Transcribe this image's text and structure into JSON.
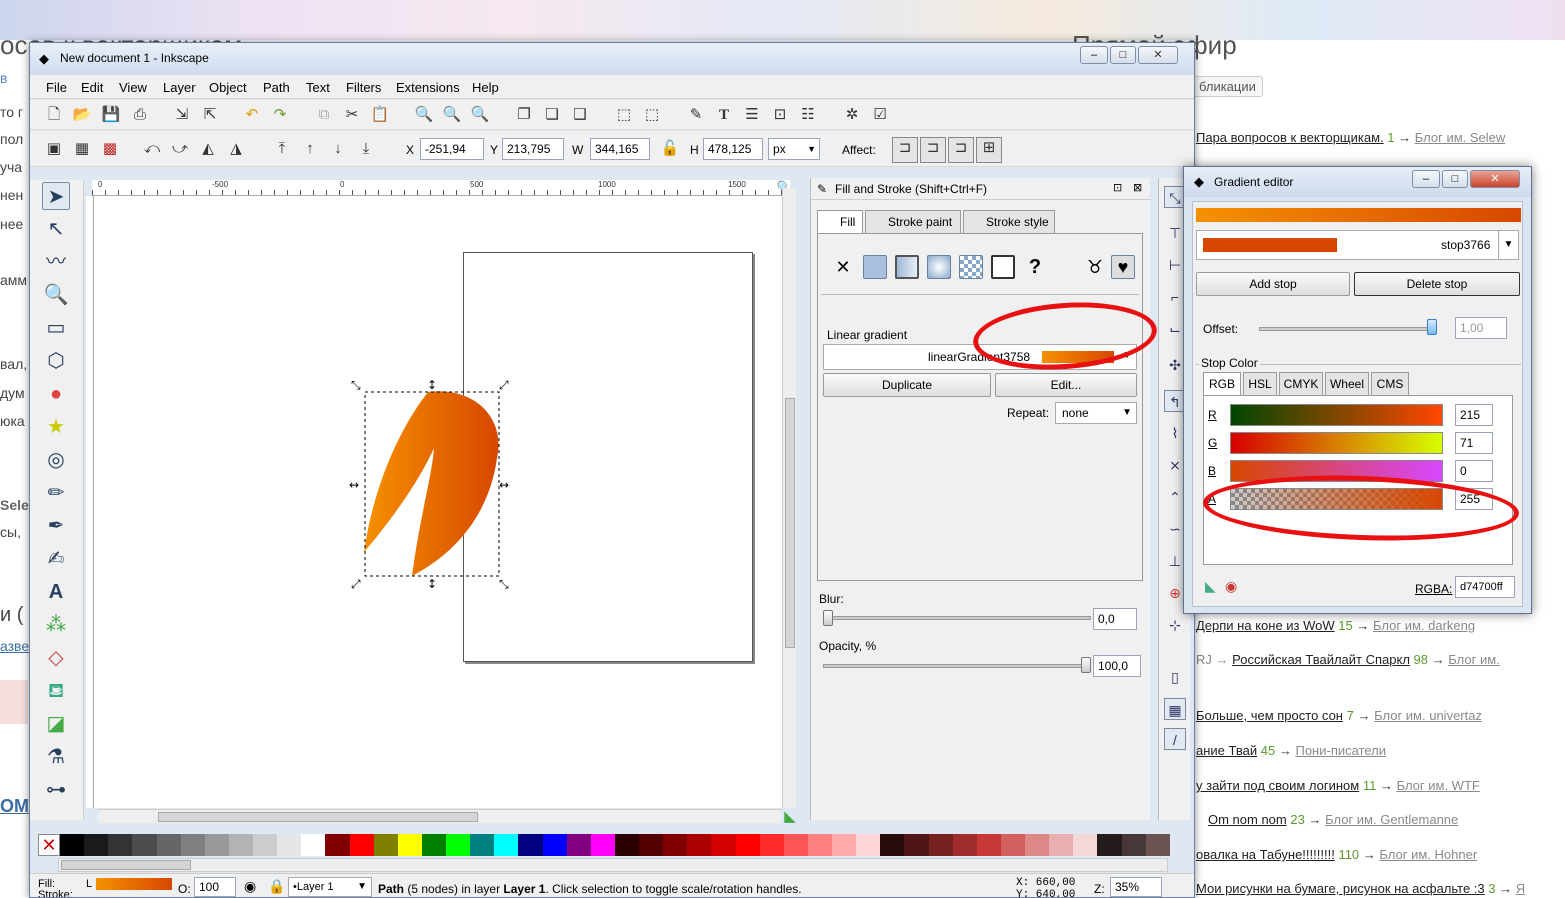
{
  "background_page": {
    "heading_left": "осов к векторщикам.",
    "heading_right": "Прямой эфир",
    "left_fragments": [
      "в",
      "то г",
      "пол",
      "уча",
      "нен",
      "нее",
      "амм",
      "вал,",
      "дум",
      "юка",
      "Sele",
      "сы, ",
      "и (",
      "азве",
      "ОМ"
    ],
    "publications_label": "бликации",
    "feed": [
      {
        "title": "Пара вопросов к векторщикам.",
        "count": "1",
        "arrow": "→",
        "blog": "Блог им. Selew"
      },
      {
        "title": "Дерпи на коне из WoW",
        "count": "15",
        "arrow": "→",
        "blog": "Блог им. darkeng"
      },
      {
        "title": "Российская Твайлайт Спаркл",
        "prefix": "RJ →",
        "count": "98",
        "arrow": "→",
        "blog": "Блог им."
      },
      {
        "title": "Больше, чем просто сон",
        "count": "7",
        "arrow": "→",
        "blog": "Блог им. univertaz"
      },
      {
        "title": "ание Твай",
        "count": "45",
        "arrow": "→",
        "blog": "Пони-писатели"
      },
      {
        "title": "у зайти под своим логином",
        "count": "11",
        "arrow": "→",
        "blog": "Блог им. WTF"
      },
      {
        "title": "Om nom nom",
        "count": "23",
        "arrow": "→",
        "blog": "Блог им. Gentlemanne"
      },
      {
        "title": "овалка на Табуне!!!!!!!!!",
        "count": "110",
        "arrow": "→",
        "blog": "Блог им. Hohner"
      },
      {
        "title": "Мои рисунки на бумаге, рисунок на асфальте :3",
        "count": "3",
        "arrow": "→",
        "blog": "Я"
      }
    ]
  },
  "window": {
    "title": "New document 1 - Inkscape",
    "controls": {
      "minimize": "–",
      "maximize": "□",
      "close": "✕"
    }
  },
  "menu": [
    "File",
    "Edit",
    "View",
    "Layer",
    "Object",
    "Path",
    "Text",
    "Filters",
    "Extensions",
    "Help"
  ],
  "tool_controls": {
    "x_label": "X",
    "x_value": "-251,94",
    "y_label": "Y",
    "y_value": "213,795",
    "w_label": "W",
    "w_value": "344,165",
    "h_label": "H",
    "h_value": "478,125",
    "unit": "px",
    "affect_label": "Affect:"
  },
  "ruler": [
    "0",
    "-500",
    "0",
    "500",
    "1000",
    "1500"
  ],
  "fill_stroke": {
    "title": "Fill and Stroke (Shift+Ctrl+F)",
    "tabs": [
      "Fill",
      "Stroke paint",
      "Stroke style"
    ],
    "mode_label": "Linear gradient",
    "gradient_name": "linearGradient3758",
    "duplicate_label": "Duplicate",
    "edit_label": "Edit...",
    "repeat_label": "Repeat:",
    "repeat_value": "none",
    "blur_label": "Blur:",
    "blur_value": "0,0",
    "opacity_label": "Opacity, %",
    "opacity_value": "100,0",
    "opacity_fraction": 1.0,
    "blur_fraction": 0.0
  },
  "gradient_editor": {
    "title": "Gradient editor",
    "stop_name": "stop3766",
    "add_stop_label": "Add stop",
    "delete_stop_label": "Delete stop",
    "offset_label": "Offset:",
    "offset_value": "1,00",
    "offset_fraction": 1.0,
    "stop_color_label": "Stop Color",
    "tabs": [
      "RGB",
      "HSL",
      "CMYK",
      "Wheel",
      "CMS"
    ],
    "channels": [
      {
        "label": "R",
        "value": "215"
      },
      {
        "label": "G",
        "value": "71"
      },
      {
        "label": "B",
        "value": "0"
      },
      {
        "label": "A",
        "value": "255"
      }
    ],
    "rgba_label": "RGBA:",
    "rgba_value": "d74700ff"
  },
  "status": {
    "fill_label": "Fill:",
    "fill_type": "L",
    "stroke_label": "Stroke:",
    "opacity_label": "O:",
    "opacity_value": "100",
    "layer_name": "•Layer 1",
    "message_lead": "Path",
    "message_nodes": "(5 nodes) in layer",
    "message_layer": "Layer 1",
    "message_tail": ". Click selection to toggle scale/rotation handles.",
    "x_coord": "X: 660,00",
    "y_coord": "Y: 640,00",
    "zoom_label": "Z:",
    "zoom_value": "35%"
  },
  "colors": {
    "gradient_start": "#f59100",
    "gradient_end": "#d74700",
    "annotation_red": "#e81010",
    "accent": "#3a6ea5"
  },
  "palette": [
    "#000000",
    "#1a1a1a",
    "#333333",
    "#4d4d4d",
    "#666666",
    "#808080",
    "#999999",
    "#b3b3b3",
    "#cccccc",
    "#e6e6e6",
    "#ffffff",
    "#800000",
    "#ff0000",
    "#808000",
    "#ffff00",
    "#008000",
    "#00ff00",
    "#008080",
    "#00ffff",
    "#000080",
    "#0000ff",
    "#800080",
    "#ff00ff",
    "#2b0000",
    "#550000",
    "#800000",
    "#aa0000",
    "#d40000",
    "#ff0000",
    "#ff2a2a",
    "#ff5555",
    "#ff8080",
    "#ffaaaa",
    "#ffd5d5",
    "#280b0b",
    "#501616",
    "#782121",
    "#a02c2c",
    "#c83737",
    "#d35f5f",
    "#de8787",
    "#e9afaf",
    "#f4d7d7",
    "#241c1c",
    "#483737",
    "#6c5353"
  ]
}
